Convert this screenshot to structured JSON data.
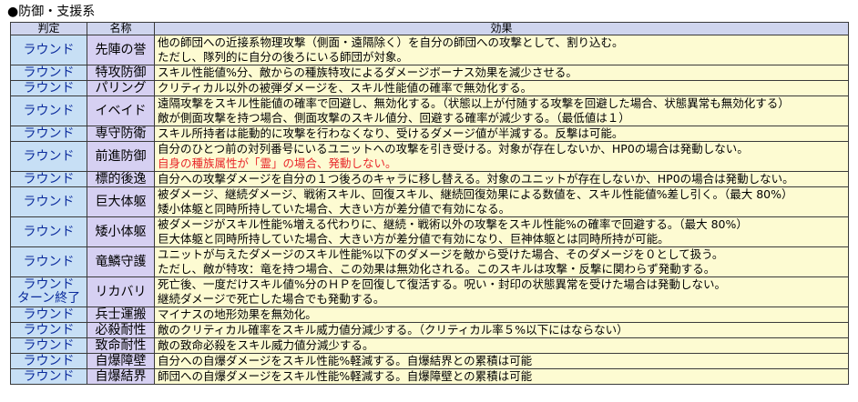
{
  "title": "●防御・支援系",
  "headers": {
    "judge": "判定",
    "name": "名称",
    "effect": "効果"
  },
  "rows": [
    {
      "judge": [
        "ラウンド"
      ],
      "name": "先陣の誉",
      "effect": [
        {
          "text": "他の師団への近接系物理攻撃（側面・遠隔除く）を自分の師団への攻撃として、割り込む。"
        },
        {
          "text": "ただし、隊列的に自分の後ろにいる師団が対象。"
        }
      ]
    },
    {
      "judge": [
        "ラウンド"
      ],
      "name": "特攻防御",
      "effect": [
        {
          "text": "スキル性能値%分、敵からの種族特攻によるダメージボーナス効果を減少させる。"
        }
      ]
    },
    {
      "judge": [
        "ラウンド"
      ],
      "name": "パリング",
      "effect": [
        {
          "text": "クリティカル以外の被弾ダメージを、スキル性能値の確率で無効化する。"
        }
      ]
    },
    {
      "judge": [
        "ラウンド"
      ],
      "name": "イベイド",
      "effect": [
        {
          "text": "遠隔攻撃をスキル性能値の確率で回避し、無効化する。（状態以上が付随する攻撃を回避した場合、状態異常も無効化する）"
        },
        {
          "text": "敵が側面攻撃を持つ場合、側面攻撃のスキル値分、回避する確率が減少する。（最低値は１）"
        }
      ]
    },
    {
      "judge": [
        "ラウンド"
      ],
      "name": "専守防衛",
      "effect": [
        {
          "text": "スキル所持者は能動的に攻撃を行わなくなり、受けるダメージ値が半減する。反撃は可能。"
        }
      ]
    },
    {
      "judge": [
        "ラウンド"
      ],
      "name": "前進防御",
      "effect": [
        {
          "text": "自分のひとつ前の対列番号にいるユニットへの攻撃を引き受ける。対象が存在しないか、HP0の場合は発動しない。"
        },
        {
          "text": "自身の種族属性が「霊」の場合、発動しない。",
          "red": true
        }
      ]
    },
    {
      "judge": [
        "ラウンド"
      ],
      "name": "標的後逸",
      "effect": [
        {
          "text": "自分への攻撃ダメージを自分の１つ後ろのキャラに移し替える。対象のユニットが存在しないか、HP0の場合は発動しない。"
        }
      ]
    },
    {
      "judge": [
        "ラウンド"
      ],
      "name": "巨大体躯",
      "effect": [
        {
          "text": "被ダメージ、継続ダメージ、戦術スキル、回復スキル、継続回復効果による数値を、スキル性能値%差し引く。（最大 80%）"
        },
        {
          "text": "矮小体躯と同時所持していた場合、大きい方が差分値で有効になる。"
        }
      ]
    },
    {
      "judge": [
        "ラウンド"
      ],
      "name": "矮小体躯",
      "effect": [
        {
          "text": "被ダメージがスキル性能%増える代わりに、継続・戦術以外の攻撃をスキル性能%の確率で回避する。（最大 80%）"
        },
        {
          "text": "巨大体躯と同時所持していた場合、大きい方が差分値で有効になり、巨神体躯とは同時所持が可能。"
        }
      ]
    },
    {
      "judge": [
        "ラウンド"
      ],
      "name": "竜鱗守護",
      "effect": [
        {
          "text": "ユニットが与えたダメージのスキル性能%以下のダメージを敵から受けた場合、そのダメージを０として扱う。"
        },
        {
          "text": "ただし、敵が特攻：竜を持つ場合、この効果は無効化される。このスキルは攻撃・反撃に関わらず発動する。"
        }
      ]
    },
    {
      "judge": [
        "ラウンド",
        "ターン終了"
      ],
      "name": "リカバリ",
      "effect": [
        {
          "text": "死亡後、一度だけスキル値%分のＨＰを回復して復活する。呪い・封印の状態異常を受けた場合は発動しない。"
        },
        {
          "text": "継続ダメージで死亡した場合でも発動する。"
        }
      ]
    },
    {
      "judge": [
        "ラウンド"
      ],
      "name": "兵士運搬",
      "effect": [
        {
          "text": "マイナスの地形効果を無効化。"
        }
      ]
    },
    {
      "judge": [
        "ラウンド"
      ],
      "name": "必殺耐性",
      "effect": [
        {
          "text": "敵のクリティカル確率をスキル威力値分減少する。（クリティカル率５%以下にはならない）"
        }
      ]
    },
    {
      "judge": [
        "ラウンド"
      ],
      "name": "致命耐性",
      "effect": [
        {
          "text": "敵の致命必殺をスキル威力値分減少する。"
        }
      ]
    },
    {
      "judge": [
        "ラウンド"
      ],
      "name": "自爆障壁",
      "effect": [
        {
          "text": "自分への自爆ダメージをスキル性能%軽減する。自爆結界との累積は可能"
        }
      ]
    },
    {
      "judge": [
        "ラウンド"
      ],
      "name": "自爆結界",
      "effect": [
        {
          "text": "師団への自爆ダメージをスキル性能%軽減する。自爆障壁との累積は可能"
        }
      ]
    }
  ]
}
